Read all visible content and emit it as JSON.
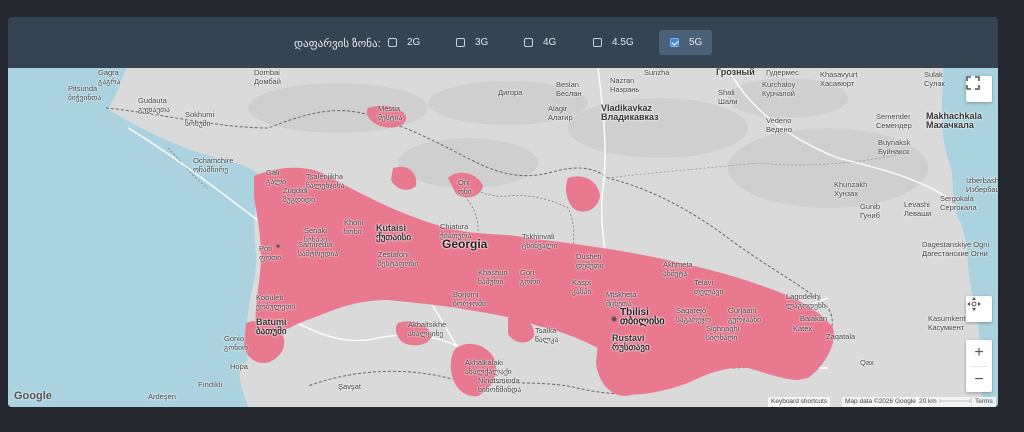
{
  "filter": {
    "label": "დაფარვის ზონა:",
    "options": [
      {
        "label": "2G",
        "checked": false
      },
      {
        "label": "3G",
        "checked": false
      },
      {
        "label": "4G",
        "checked": false
      },
      {
        "label": "4.5G",
        "checked": false
      },
      {
        "label": "5G",
        "checked": true
      }
    ]
  },
  "map": {
    "coverage_color": "#e8798f",
    "sea_color": "#aad3df",
    "land_color": "#dadada",
    "places": {
      "country": "Georgia",
      "capital_latin": "Tbilisi",
      "capital_local": "თბილისი",
      "cities": [
        {
          "latin": "Gagra",
          "local": "გაგრა"
        },
        {
          "latin": "Pitsunda",
          "local": "ბიჭვინთა"
        },
        {
          "latin": "Gudauta",
          "local": "გუდაუთა"
        },
        {
          "latin": "Sokhumi",
          "local": "სოხუმი"
        },
        {
          "latin": "Ochamchire",
          "local": "ოჩამჩირე"
        },
        {
          "latin": "Gali",
          "local": "გალი"
        },
        {
          "latin": "Tsalenjikha",
          "local": "წალენჯიხა"
        },
        {
          "latin": "Zugdidi",
          "local": "ზუგდიდი"
        },
        {
          "latin": "Mestia",
          "local": "მესტია"
        },
        {
          "latin": "Senaki",
          "local": "სენაკი"
        },
        {
          "latin": "Khoni",
          "local": "ხონი"
        },
        {
          "latin": "Kutaisi",
          "local": "ქუთაისი"
        },
        {
          "latin": "Poti",
          "local": "ფოთი"
        },
        {
          "latin": "Samtredia",
          "local": "სამტრედია"
        },
        {
          "latin": "Zestafoni",
          "local": "ზესტაფონი"
        },
        {
          "latin": "Chiatura",
          "local": "ჭიათურა"
        },
        {
          "latin": "Oni",
          "local": "ონი"
        },
        {
          "latin": "Tskhinvali",
          "local": "ცხინვალი"
        },
        {
          "latin": "Khashuri",
          "local": "ხაშური"
        },
        {
          "latin": "Gori",
          "local": "გორი"
        },
        {
          "latin": "Dusheti",
          "local": "დუშეთი"
        },
        {
          "latin": "Kaspi",
          "local": "კასპი"
        },
        {
          "latin": "Mtskheta",
          "local": "მცხეთა"
        },
        {
          "latin": "Borjomi",
          "local": "ბორჯომი"
        },
        {
          "latin": "Kobuleti",
          "local": "ქობულეთი"
        },
        {
          "latin": "Batumi",
          "local": "ბათუმი"
        },
        {
          "latin": "Akhaltsikhe",
          "local": "ახალციხე"
        },
        {
          "latin": "Akhalkalaki",
          "local": "ახალქალაქი"
        },
        {
          "latin": "Ninotsminda",
          "local": "ნინოწმინდა"
        },
        {
          "latin": "Tsalka",
          "local": "წალკა"
        },
        {
          "latin": "Rustavi",
          "local": "რუსთავი"
        },
        {
          "latin": "Akhmeta",
          "local": "ახმეტა"
        },
        {
          "latin": "Telavi",
          "local": "თელავი"
        },
        {
          "latin": "Sagarejo",
          "local": "საგარეჯო"
        },
        {
          "latin": "Gurjaani",
          "local": "გურჯაანი"
        },
        {
          "latin": "Sighnaghi",
          "local": "სიღნაღი"
        },
        {
          "latin": "Lagodekhi",
          "local": "ლაგოდეხი"
        },
        {
          "latin": "Gonio",
          "local": "გონიო"
        }
      ],
      "north": [
        {
          "a": "Dombai",
          "b": "Домбай"
        },
        {
          "a": "Beslan",
          "b": "Беслан"
        },
        {
          "a": "Nazran",
          "b": "Назрань"
        },
        {
          "a": "Sunzha",
          "b": "Сунжа"
        },
        {
          "a": "Grozny",
          "b": "Грозный"
        },
        {
          "a": "Gudermes",
          "b": "Гудермес"
        },
        {
          "a": "Khasavyurt",
          "b": "Хасавюрт"
        },
        {
          "a": "Sulak",
          "b": "Сулак"
        },
        {
          "a": "Digora",
          "b": "Дигора"
        },
        {
          "a": "Alagir",
          "b": "Алагир"
        },
        {
          "a": "Vladikavkaz",
          "b": "Владикавказ"
        },
        {
          "a": "Shali",
          "b": "Шали"
        },
        {
          "a": "Kurchaloy",
          "b": "Курчалой"
        },
        {
          "a": "Makhachkala",
          "b": "Махачкала"
        },
        {
          "a": "Vedeno",
          "b": "Ведено"
        },
        {
          "a": "Semender",
          "b": "Семендер"
        },
        {
          "a": "Buynaksk",
          "b": "Буйнакск"
        },
        {
          "a": "Khunzakh",
          "b": "Хунзах"
        },
        {
          "a": "Gunib",
          "b": "Гуниб"
        },
        {
          "a": "Levashi",
          "b": "Леваши"
        },
        {
          "a": "Sergokala",
          "b": "Сергокала"
        },
        {
          "a": "Izberbash",
          "b": "Избербаш"
        },
        {
          "a": "Dagestanskiye Ogni",
          "b": "Дагестанские Огни"
        }
      ],
      "south": [
        {
          "a": "Hopa"
        },
        {
          "a": "Fındıklı"
        },
        {
          "a": "Ardeşen"
        },
        {
          "a": "Şavşat"
        },
        {
          "a": "Balakan"
        },
        {
          "a": "Katex"
        },
        {
          "a": "Qax"
        },
        {
          "a": "Zaqatala"
        },
        {
          "a": "Kasumkent",
          "b": "Касумкент"
        }
      ]
    },
    "controls": {
      "fullscreen_icon": "fullscreen-icon",
      "camera_icon": "camera-move-icon",
      "zoom_in": "+",
      "zoom_out": "−"
    },
    "attribution": {
      "logo": "Google",
      "shortcuts": "Keyboard shortcuts",
      "data": "Map data ©2026 Google",
      "scale": "20 km",
      "terms": "Terms"
    }
  }
}
